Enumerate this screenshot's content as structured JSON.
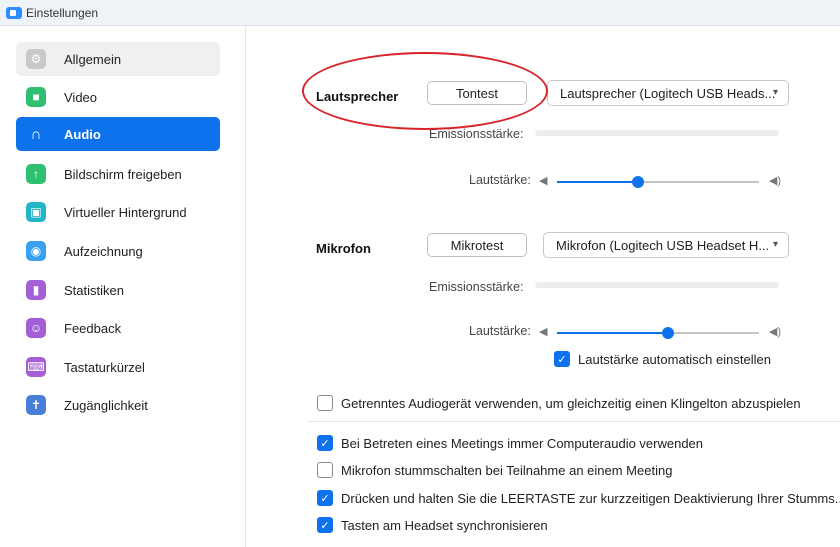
{
  "window": {
    "title": "Einstellungen"
  },
  "sidebar": {
    "items": [
      {
        "label": "Allgemein",
        "icon": "gear-icon",
        "color": "#c8c8c8"
      },
      {
        "label": "Video",
        "icon": "video-camera-icon",
        "color": "#2fbf71"
      },
      {
        "label": "Audio",
        "icon": "headphones-icon",
        "color": "#0e72ed"
      },
      {
        "label": "Bildschirm freigeben",
        "icon": "share-screen-icon",
        "color": "#2fbf71"
      },
      {
        "label": "Virtueller Hintergrund",
        "icon": "virtual-background-icon",
        "color": "#21b5c8"
      },
      {
        "label": "Aufzeichnung",
        "icon": "record-icon",
        "color": "#3aa0f0"
      },
      {
        "label": "Statistiken",
        "icon": "statistics-icon",
        "color": "#a45ed6"
      },
      {
        "label": "Feedback",
        "icon": "feedback-smile-icon",
        "color": "#a45ed6"
      },
      {
        "label": "Tastaturkürzel",
        "icon": "keyboard-icon",
        "color": "#a45ed6"
      },
      {
        "label": "Zugänglichkeit",
        "icon": "accessibility-icon",
        "color": "#4a7fd9"
      }
    ]
  },
  "speaker": {
    "label": "Lautsprecher",
    "test_button": "Tontest",
    "device": "Lautsprecher (Logitech USB Heads...",
    "emission_label": "Emissionsstärke:",
    "volume_label": "Lautstärke:",
    "volume_level": 0.4
  },
  "microphone": {
    "label": "Mikrofon",
    "test_button": "Mikrotest",
    "device": "Mikrofon (Logitech USB Headset H...",
    "emission_label": "Emissionsstärke:",
    "volume_label": "Lautstärke:",
    "volume_level": 0.55,
    "auto_adjust_label": "Lautstärke automatisch einstellen",
    "auto_adjust_checked": true
  },
  "options": [
    {
      "label": "Getrenntes Audiogerät verwenden, um gleichzeitig einen Klingelton abzuspielen",
      "checked": false
    },
    {
      "label": "Bei Betreten eines Meetings immer Computeraudio verwenden",
      "checked": true
    },
    {
      "label": "Mikrofon stummschalten bei Teilnahme an einem Meeting",
      "checked": false
    },
    {
      "label": "Drücken und halten Sie die LEERTASTE zur kurzzeitigen Deaktivierung Ihrer Stumms...",
      "checked": true
    },
    {
      "label": "Tasten am Headset synchronisieren",
      "checked": true
    }
  ],
  "colors": {
    "accent": "#0e72ed",
    "annotation": "#d8242b"
  }
}
